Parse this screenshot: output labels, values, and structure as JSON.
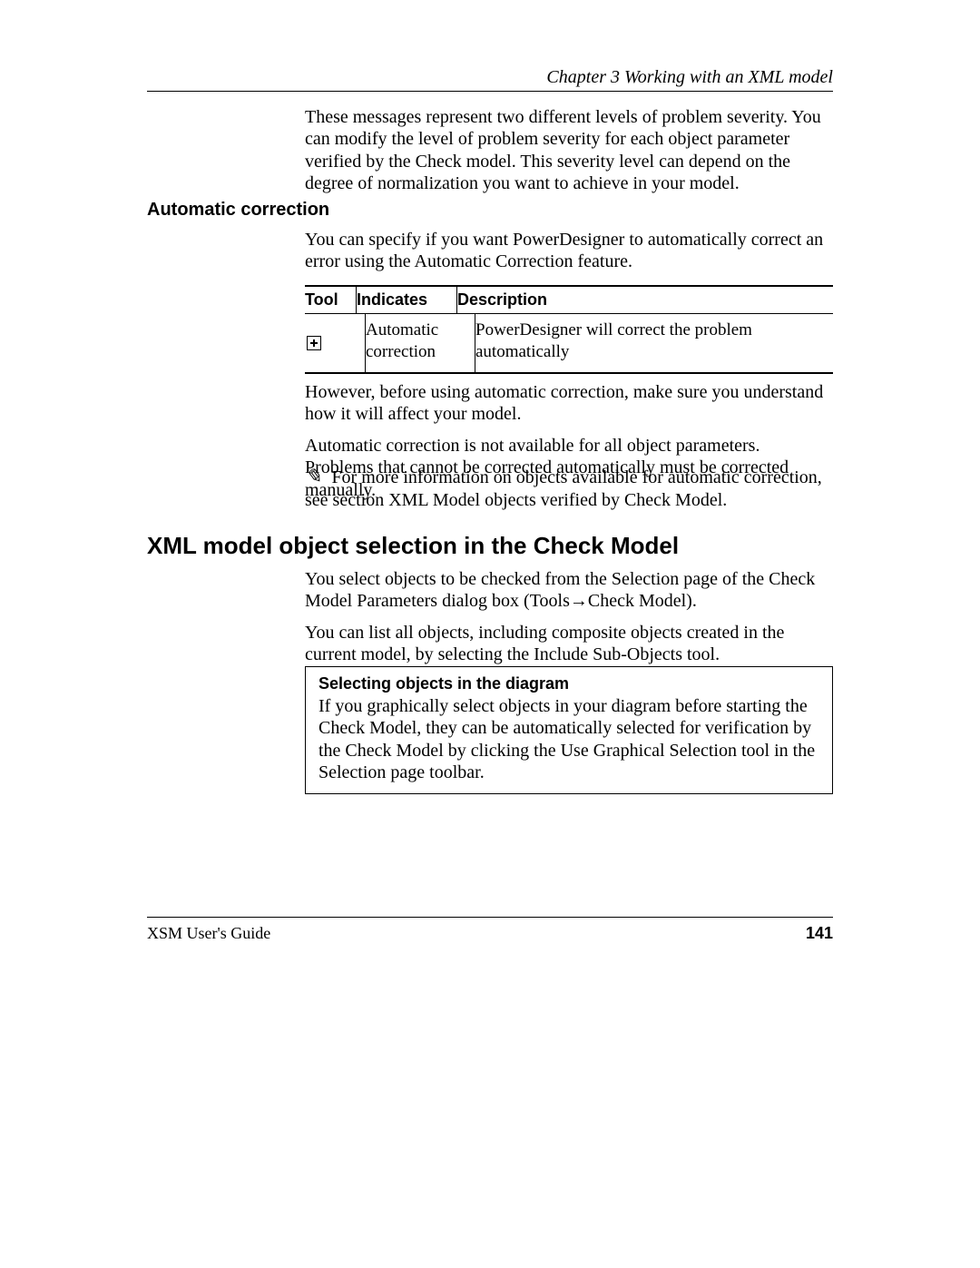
{
  "header": {
    "chapter": "Chapter 3    Working with an XML model"
  },
  "intro": {
    "p1": "These messages represent two different levels of problem severity. You can modify the level of problem severity for each object parameter verified by the Check model. This severity level can depend on the degree of normalization you want to achieve in your model."
  },
  "auto": {
    "heading": "Automatic correction",
    "p1": "You can specify if you want PowerDesigner to automatically correct an error using the Automatic Correction feature.",
    "table": {
      "headers": {
        "tool": "Tool",
        "indicates": "Indicates",
        "description": "Description"
      },
      "row": {
        "indicates": "Automatic correction",
        "description": "PowerDesigner will correct the problem automatically"
      }
    },
    "p2": "However, before using automatic correction, make sure you understand how it will affect your model.",
    "p3": "Automatic correction is not available for all object parameters. Problems that cannot be corrected automatically must be corrected manually.",
    "info": "For more information on objects available for automatic correction, see section XML Model objects verified by Check Model."
  },
  "xml": {
    "heading": "XML model object selection in the Check Model",
    "p1": "You select objects to be checked from the Selection page of the Check Model Parameters dialog box (Tools→Check Model).",
    "p2": "You can list all objects, including composite objects created in the current model, by selecting the Include Sub-Objects tool."
  },
  "note": {
    "title": "Selecting objects in the diagram",
    "text": "If you graphically select objects in your diagram before starting the Check Model, they can be automatically selected for verification by the Check Model by clicking the Use Graphical Selection tool in the Selection page toolbar."
  },
  "footer": {
    "left": "XSM User's Guide",
    "page": "141"
  }
}
